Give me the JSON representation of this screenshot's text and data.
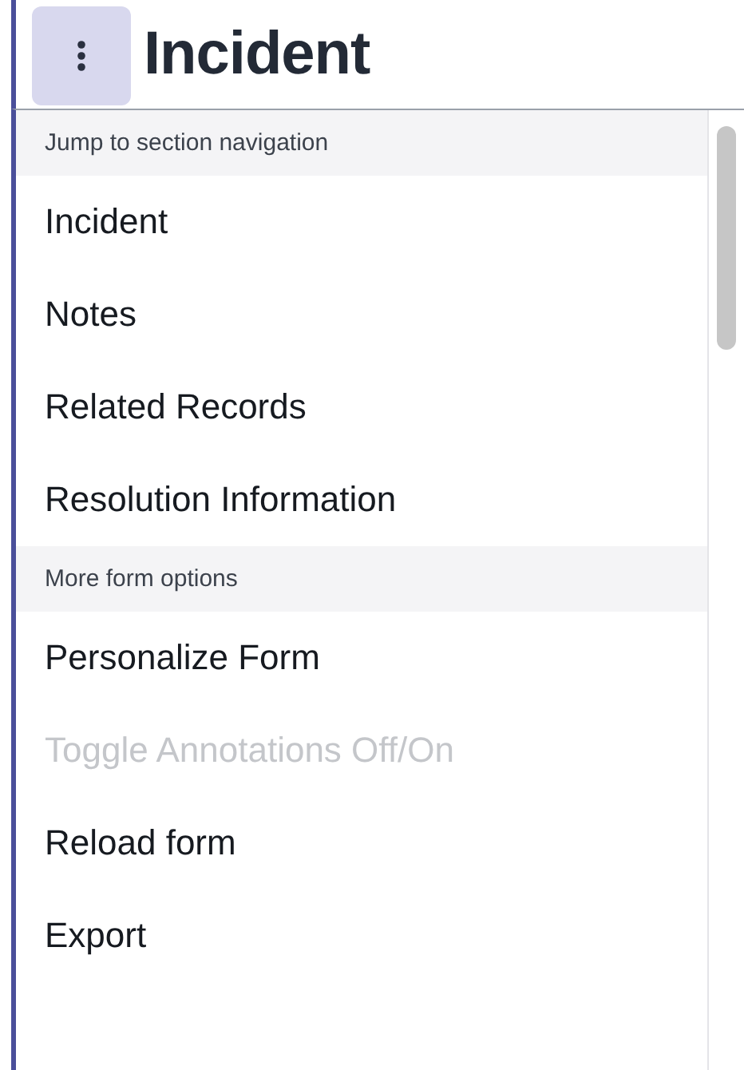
{
  "header": {
    "title": "Incident"
  },
  "menu": {
    "sections": [
      {
        "heading": "Jump to section navigation",
        "items": [
          {
            "label": "Incident",
            "disabled": false
          },
          {
            "label": "Notes",
            "disabled": false
          },
          {
            "label": "Related Records",
            "disabled": false
          },
          {
            "label": "Resolution Information",
            "disabled": false
          }
        ]
      },
      {
        "heading": "More form options",
        "items": [
          {
            "label": "Personalize Form",
            "disabled": false
          },
          {
            "label": "Toggle Annotations Off/On",
            "disabled": true
          },
          {
            "label": "Reload form",
            "disabled": false
          },
          {
            "label": "Export",
            "disabled": false
          }
        ]
      }
    ]
  }
}
